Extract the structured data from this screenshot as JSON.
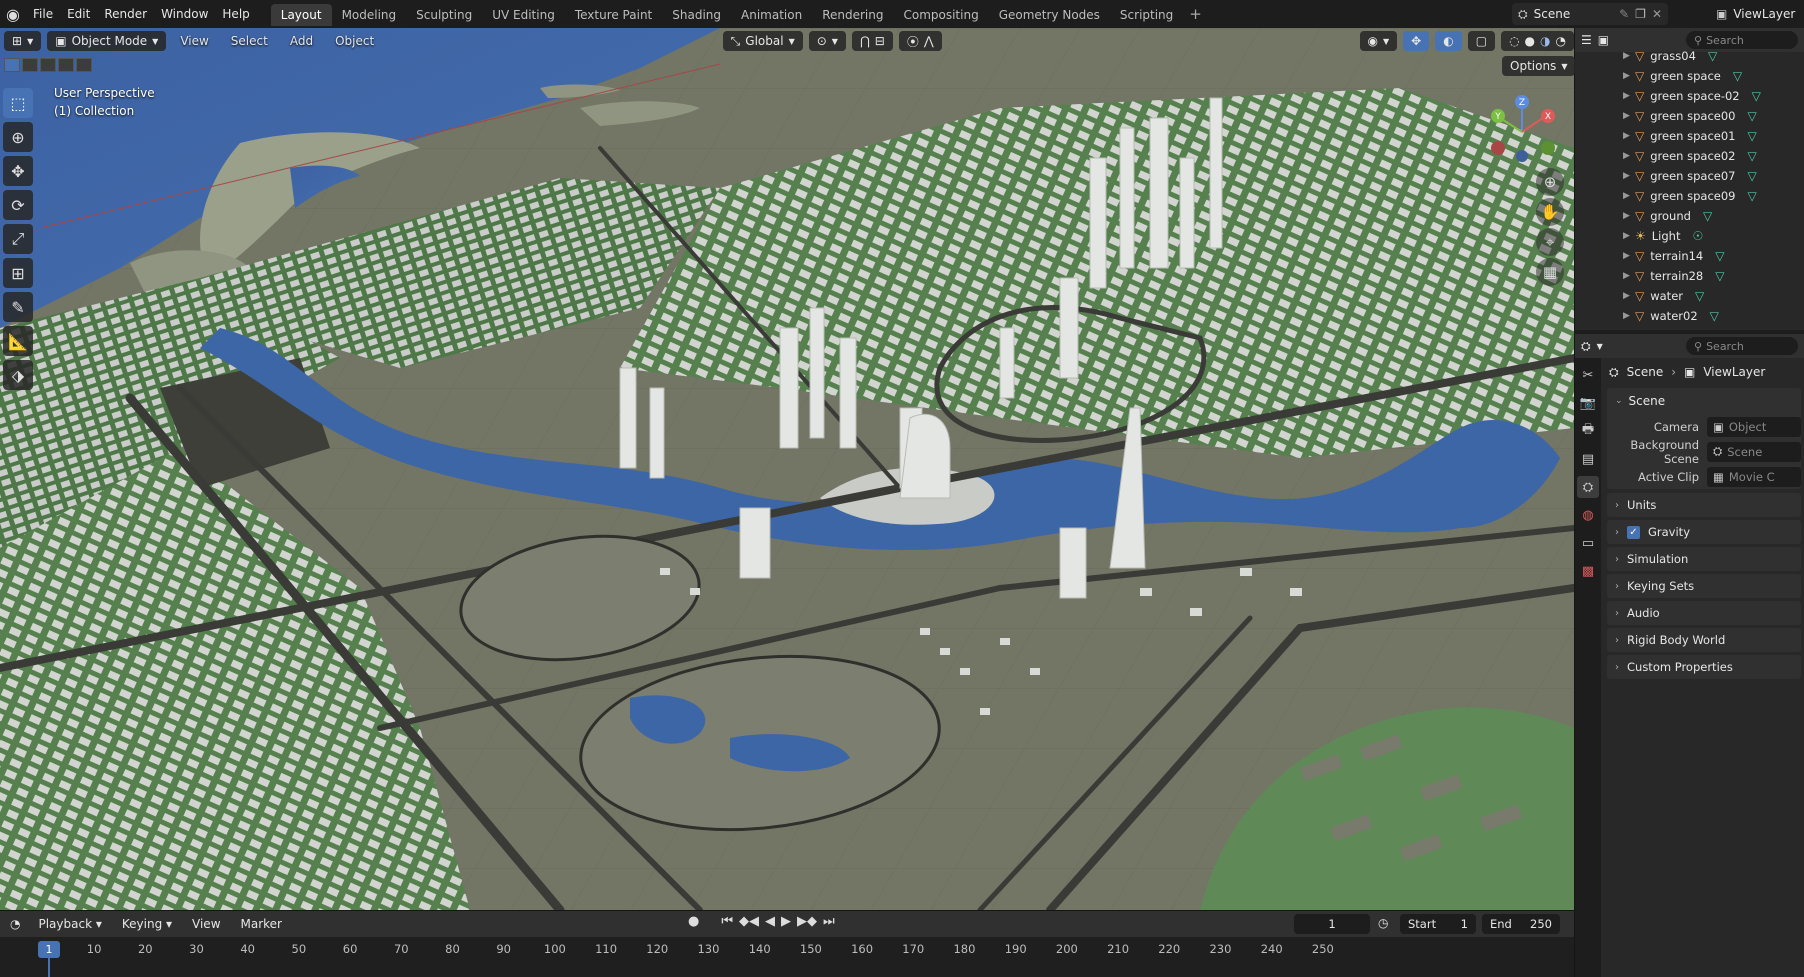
{
  "topbar": {
    "menus": [
      "File",
      "Edit",
      "Render",
      "Window",
      "Help"
    ],
    "workspaces": [
      "Layout",
      "Modeling",
      "Sculpting",
      "UV Editing",
      "Texture Paint",
      "Shading",
      "Animation",
      "Rendering",
      "Compositing",
      "Geometry Nodes",
      "Scripting"
    ],
    "active_workspace": "Layout",
    "add_workspace": "+",
    "scene": "Scene",
    "view_layer": "ViewLayer"
  },
  "viewport": {
    "mode": "Object Mode",
    "menus": [
      "View",
      "Select",
      "Add",
      "Object"
    ],
    "transform_orientation": "Global",
    "options": "Options",
    "info_line1": "User Perspective",
    "info_line2": "(1) Collection",
    "gizmo_axes": [
      "X",
      "Y",
      "Z"
    ]
  },
  "outliner": {
    "search_placeholder": "Search",
    "items": [
      {
        "name": "grass04",
        "type": "mesh"
      },
      {
        "name": "green space",
        "type": "mesh"
      },
      {
        "name": "green space-02",
        "type": "mesh"
      },
      {
        "name": "green space00",
        "type": "mesh"
      },
      {
        "name": "green space01",
        "type": "mesh"
      },
      {
        "name": "green space02",
        "type": "mesh"
      },
      {
        "name": "green space07",
        "type": "mesh"
      },
      {
        "name": "green space09",
        "type": "mesh"
      },
      {
        "name": "ground",
        "type": "mesh"
      },
      {
        "name": "Light",
        "type": "light"
      },
      {
        "name": "terrain14",
        "type": "mesh"
      },
      {
        "name": "terrain28",
        "type": "mesh"
      },
      {
        "name": "water",
        "type": "mesh"
      },
      {
        "name": "water02",
        "type": "mesh"
      }
    ]
  },
  "properties": {
    "search_placeholder": "Search",
    "breadcrumb_scene": "Scene",
    "breadcrumb_viewlayer": "ViewLayer",
    "panel_title": "Scene",
    "camera_label": "Camera",
    "camera_value": "Object",
    "bg_scene_label": "Background Scene",
    "bg_scene_value": "Scene",
    "active_clip_label": "Active Clip",
    "active_clip_value": "Movie C",
    "subpanels": [
      "Units",
      "Gravity",
      "Simulation",
      "Keying Sets",
      "Audio",
      "Rigid Body World",
      "Custom Properties"
    ]
  },
  "timeline": {
    "menus": [
      "Playback",
      "Keying",
      "View",
      "Marker"
    ],
    "current_frame": "1",
    "start_label": "Start",
    "start_value": "1",
    "end_label": "End",
    "end_value": "250",
    "ticks": [
      "1",
      "10",
      "20",
      "30",
      "40",
      "50",
      "60",
      "70",
      "80",
      "90",
      "100",
      "110",
      "120",
      "130",
      "140",
      "150",
      "160",
      "170",
      "180",
      "190",
      "200",
      "210",
      "220",
      "230",
      "240",
      "250"
    ]
  },
  "colors": {
    "accent": "#4772b3",
    "mesh_icon": "#e59b5a",
    "modifier_icon": "#4ec9a8",
    "water": "#3d66a6",
    "ground": "#737565",
    "greenery": "#4b7a45"
  }
}
